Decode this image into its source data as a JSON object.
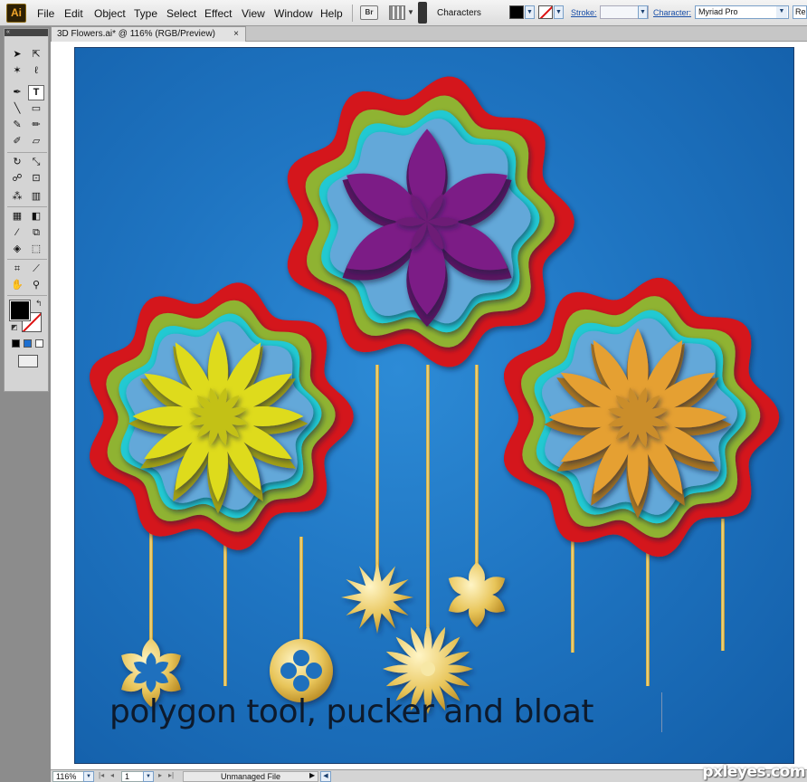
{
  "app": {
    "logo": "Ai"
  },
  "menus": [
    "File",
    "Edit",
    "Object",
    "Type",
    "Select",
    "Effect",
    "View",
    "Window",
    "Help"
  ],
  "toolbar": {
    "bridge_label": "Br",
    "panel_label": "Characters",
    "stroke_label": "Stroke:",
    "character_label": "Character:",
    "font_value": "Myriad Pro",
    "font_next_value": "Re"
  },
  "tools_header": "«",
  "document": {
    "tab_title": "3D Flowers.ai* @ 116% (RGB/Preview)",
    "close_glyph": "×",
    "caption": "polygon tool, pucker and bloat"
  },
  "statusbar": {
    "zoom": "116%",
    "page": "1",
    "file_status": "Unmanaged File"
  },
  "watermark": "pxleyes.com",
  "colors": {
    "artboard": "#1f75c2",
    "red_ring": "#d4121a",
    "green_ring": "#8fb330",
    "cyan_ring": "#22c9d2",
    "purple_flower": "#7c1d86",
    "yellow_flower": "#dedb1c",
    "orange_flower": "#e5a030",
    "gold": "#e8c55a"
  },
  "icons": [
    "selection-icon",
    "direct-selection-icon",
    "magic-wand-icon",
    "lasso-icon",
    "pen-icon",
    "type-icon",
    "line-icon",
    "rectangle-icon",
    "paintbrush-icon",
    "pencil-icon",
    "blob-brush-icon",
    "eraser-icon",
    "rotate-icon",
    "scale-icon",
    "warp-icon",
    "free-transform-icon",
    "symbol-sprayer-icon",
    "graph-icon",
    "mesh-icon",
    "gradient-icon",
    "eyedropper-icon",
    "blend-icon",
    "live-paint-icon",
    "live-paint-select-icon",
    "artboard-icon",
    "slice-icon",
    "hand-icon",
    "zoom-icon"
  ]
}
